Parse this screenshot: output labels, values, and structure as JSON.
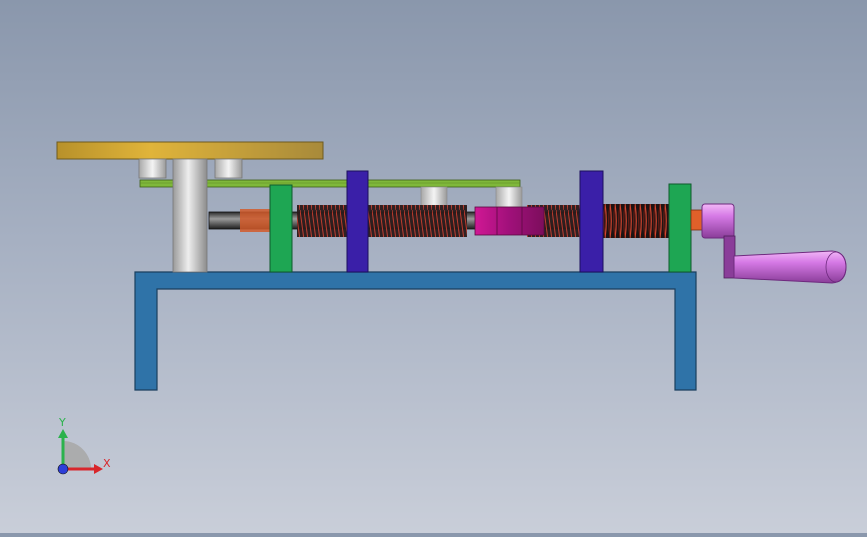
{
  "viewport": {
    "background_top": "#8a97ac",
    "background_bottom": "#c9ced9"
  },
  "model": {
    "parts": [
      "frame-base",
      "turntable-plate",
      "vertical-column",
      "bearing-block-left",
      "bearing-block-right",
      "upper-guide-rail",
      "lead-screw-shaft",
      "threaded-section",
      "spring-coil",
      "support-plate-green-left",
      "support-plate-blue-left",
      "support-plate-blue-right",
      "support-plate-green-right",
      "slider-nut",
      "hand-crank"
    ],
    "colors": {
      "frame": "#2f73a8",
      "frame_edge": "#1a3f5e",
      "turntable": "#c9a332",
      "green_plate": "#1ea653",
      "blue_plate": "#3a1fa8",
      "slider": "#c4168e",
      "crank": "#d776e8",
      "shaft": "#4a4a4a",
      "column": "#c7c7c7",
      "rail": "#7fb83a"
    }
  },
  "triad": {
    "x_label": "X",
    "y_label": "Y",
    "x_color": "#d8262b",
    "y_color": "#2bb24c",
    "z_color": "#2d3ed8"
  }
}
